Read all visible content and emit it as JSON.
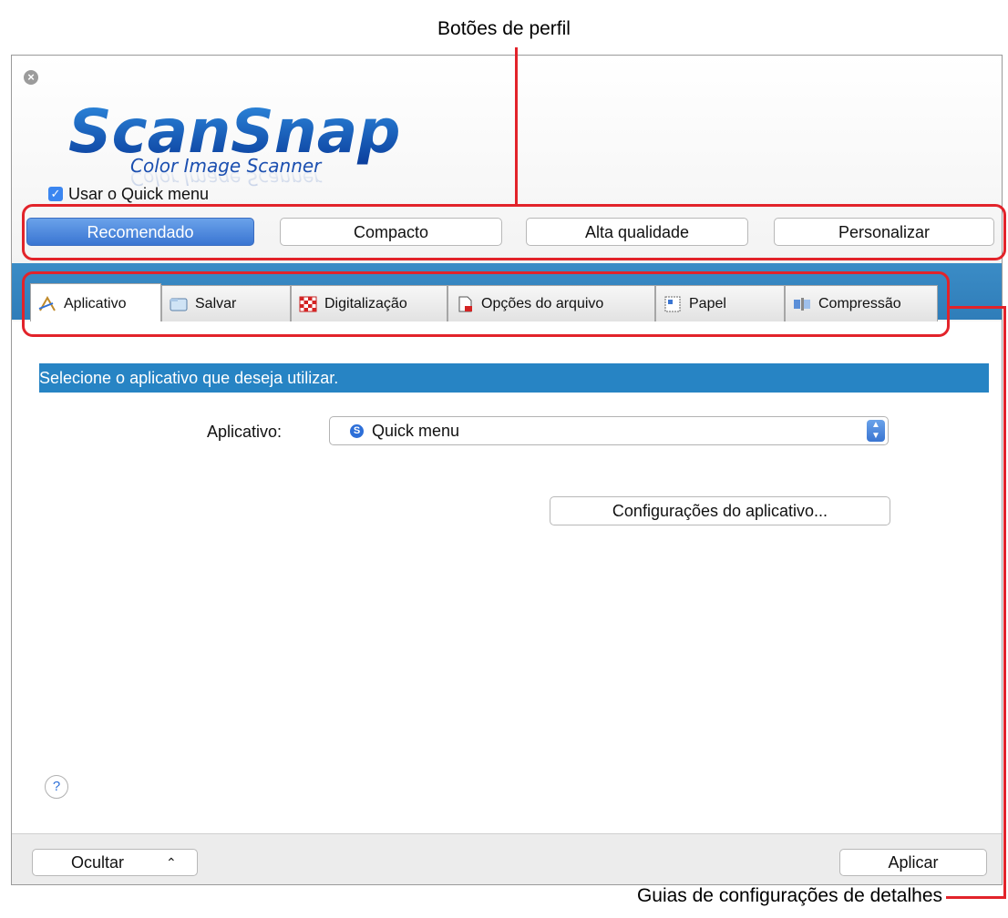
{
  "annotations": {
    "profile_buttons": "Botões de perfil",
    "detail_tabs": "Guias de configurações de detalhes"
  },
  "window": {
    "close_icon": "close-icon",
    "logo": {
      "brand": "ScanSnap",
      "tagline": "Color Image Scanner"
    },
    "quick_menu_checkbox": {
      "label": "Usar o Quick menu",
      "checked": true
    },
    "profiles": [
      {
        "label": "Recomendado",
        "active": true
      },
      {
        "label": "Compacto",
        "active": false
      },
      {
        "label": "Alta qualidade",
        "active": false
      },
      {
        "label": "Personalizar",
        "active": false
      }
    ],
    "tabs": [
      {
        "label": "Aplicativo",
        "icon": "application-icon",
        "active": true
      },
      {
        "label": "Salvar",
        "icon": "folder-icon"
      },
      {
        "label": "Digitalização",
        "icon": "checkerboard-icon"
      },
      {
        "label": "Opções do arquivo",
        "icon": "file-icon"
      },
      {
        "label": "Papel",
        "icon": "paper-icon"
      },
      {
        "label": "Compressão",
        "icon": "compression-icon"
      }
    ],
    "section_title": "Selecione o aplicativo que deseja utilizar.",
    "app_field": {
      "label": "Aplicativo:",
      "value": "Quick menu"
    },
    "app_settings_button": "Configurações do aplicativo...",
    "help": "?",
    "footer": {
      "hide_label": "Ocultar",
      "apply_label": "Aplicar"
    }
  },
  "colors": {
    "accent_red": "#e2232a",
    "blue_band": "#2f7db9",
    "active_blue": "#3a75d2"
  }
}
